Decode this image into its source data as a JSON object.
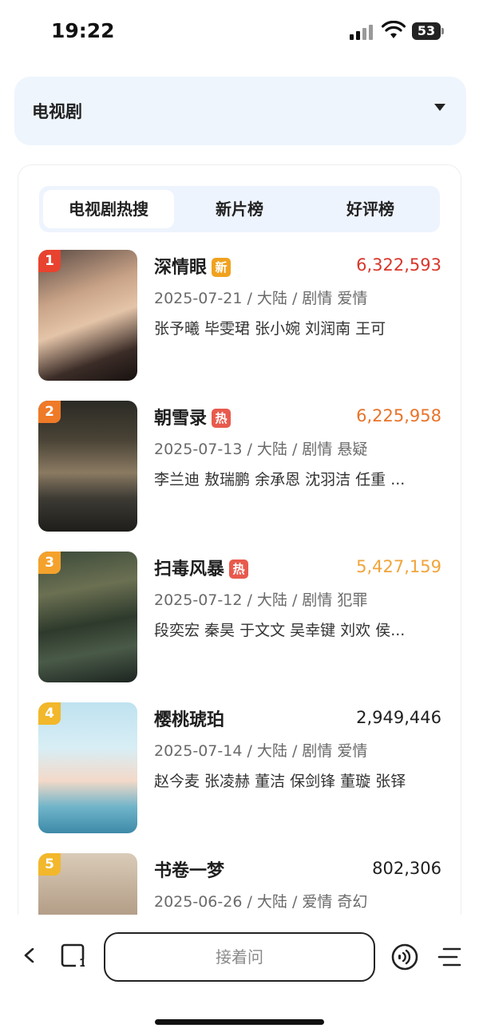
{
  "status_bar": {
    "time": "19:22",
    "battery": "53"
  },
  "category_select": {
    "value": "电视剧"
  },
  "tabs": [
    {
      "label": "电视剧热搜",
      "active": true
    },
    {
      "label": "新片榜",
      "active": false
    },
    {
      "label": "好评榜",
      "active": false
    }
  ],
  "items": [
    {
      "rank": "1",
      "title": "深情眼",
      "tag": "新",
      "score": "6,322,593",
      "meta": "2025-07-21 / 大陆 / 剧情 爱情",
      "cast": "张予曦 毕雯珺 张小婉 刘润南 王可"
    },
    {
      "rank": "2",
      "title": "朝雪录",
      "tag": "热",
      "score": "6,225,958",
      "meta": "2025-07-13 / 大陆 / 剧情 悬疑",
      "cast": "李兰迪 敖瑞鹏 余承恩 沈羽洁 任重 ..."
    },
    {
      "rank": "3",
      "title": "扫毒风暴",
      "tag": "热",
      "score": "5,427,159",
      "meta": "2025-07-12 / 大陆 / 剧情 犯罪",
      "cast": "段奕宏 秦昊 于文文 吴幸键 刘欢 侯..."
    },
    {
      "rank": "4",
      "title": "樱桃琥珀",
      "tag": "",
      "score": "2,949,446",
      "meta": "2025-07-14 / 大陆 / 剧情 爱情",
      "cast": "赵今麦 张凌赫 董洁 保剑锋 董璇 张铎"
    },
    {
      "rank": "5",
      "title": "书卷一梦",
      "tag": "",
      "score": "802,306",
      "meta": "2025-06-26 / 大陆 / 爱情 奇幻",
      "cast": ""
    }
  ],
  "bottom_bar": {
    "input_placeholder": "接着问"
  },
  "colors": {
    "rank_1": "#e8432f",
    "rank_2": "#ef7a27",
    "rank_3": "#f4a22c",
    "rank_other": "#f2b72b",
    "score_1": "#d9362b",
    "score_2": "#e8742a",
    "score_3": "#f0a43a",
    "score_other": "#1f1f1f",
    "tag_new": "#f0a21f",
    "tag_hot": "#e85a4d"
  }
}
